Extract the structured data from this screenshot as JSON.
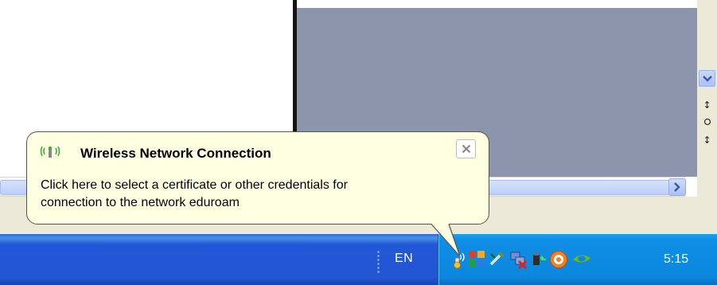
{
  "balloon": {
    "title": "Wireless Network Connection",
    "message_line1": "Click here to select a certificate or other credentials for",
    "message_line2": "connection to the network eduroam",
    "title_icon": "wireless-signal-icon",
    "close_icon": "close-icon"
  },
  "taskbar": {
    "language": "EN",
    "clock": "5:15",
    "tray_icons": [
      "wireless-network-icon",
      "network-puzzle-icon",
      "tool-icon",
      "network-disconnected-icon",
      "audio-icon",
      "orange-circle-app-icon",
      "nvidia-icon"
    ]
  },
  "scrollbar": {
    "down_icon": "chevron-down-icon",
    "right_icon": "chevron-right-icon",
    "side_controls": [
      "double-up-arrow-icon",
      "circle-icon",
      "double-down-arrow-icon"
    ]
  },
  "colors": {
    "taskbar_blue": "#2356d2",
    "tray_blue": "#0c87dd",
    "balloon_bg": "#ffffe1",
    "background_panel": "#8d95ad"
  }
}
